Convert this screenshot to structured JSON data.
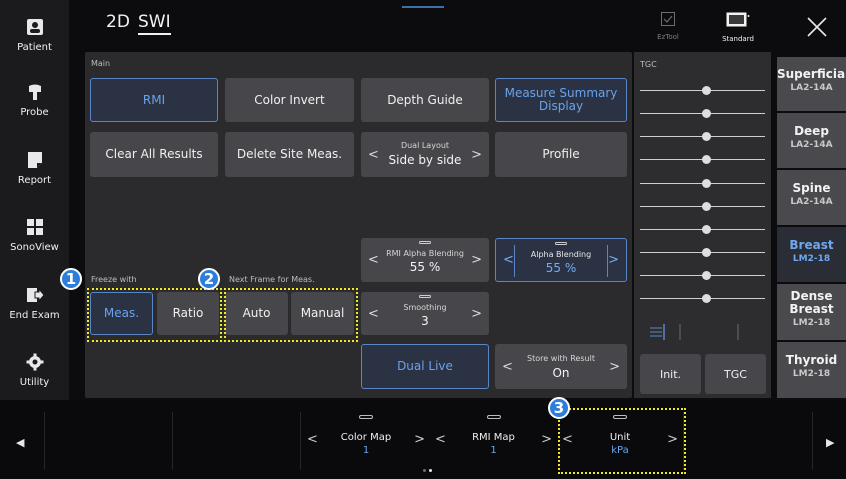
{
  "sidebar": {
    "items": [
      {
        "label": "Patient",
        "icon": "patient-icon"
      },
      {
        "label": "Probe",
        "icon": "probe-icon"
      },
      {
        "label": "Report",
        "icon": "report-icon"
      },
      {
        "label": "SonoView",
        "icon": "sonoview-icon"
      },
      {
        "label": "End Exam",
        "icon": "end-exam-icon"
      },
      {
        "label": "Utility",
        "icon": "gear-icon"
      }
    ]
  },
  "header": {
    "mode_2d": "2D",
    "mode_swi": "SWI",
    "eztool_label": "EzTool",
    "standard_label": "Standard"
  },
  "main": {
    "section_main": "Main",
    "rmi": "RMI",
    "color_invert": "Color Invert",
    "depth_guide": "Depth Guide",
    "measure_summary": "Measure Summary Display",
    "clear_all": "Clear All Results",
    "delete_site": "Delete Site Meas.",
    "dual_layout": {
      "caption": "Dual Layout",
      "value": "Side by side"
    },
    "profile": "Profile",
    "rmi_alpha": {
      "caption": "RMI Alpha Blending",
      "value": "55 %"
    },
    "alpha_blending": {
      "caption": "Alpha Blending",
      "value": "55 %"
    },
    "freeze_with_label": "Freeze with",
    "meas": "Meas.",
    "ratio": "Ratio",
    "next_frame_label": "Next Frame for Meas.",
    "auto": "Auto",
    "manual": "Manual",
    "smoothing": {
      "caption": "Smoothing",
      "value": "3"
    },
    "dual_live": "Dual Live",
    "store_with_result": {
      "caption": "Store with Result",
      "value": "On"
    }
  },
  "tgc": {
    "label": "TGC",
    "init": "Init.",
    "tgc_button": "TGC"
  },
  "presets": [
    {
      "name": "Superficial",
      "transducer": "LA2-14A",
      "active": false
    },
    {
      "name": "Deep",
      "transducer": "LA2-14A",
      "active": false
    },
    {
      "name": "Spine",
      "transducer": "LA2-14A",
      "active": false
    },
    {
      "name": "Breast",
      "transducer": "LM2-18",
      "active": true
    },
    {
      "name": "Dense Breast",
      "transducer": "LM2-18",
      "active": false
    },
    {
      "name": "Thyroid",
      "transducer": "LM2-18",
      "active": false
    }
  ],
  "bottom": {
    "color_map": {
      "caption": "Color Map",
      "value": "1"
    },
    "rmi_map": {
      "caption": "RMI Map",
      "value": "1"
    },
    "unit": {
      "caption": "Unit",
      "value": "kPa"
    }
  },
  "callouts": [
    "1",
    "2",
    "3"
  ],
  "colors": {
    "accent": "#68a3ec",
    "highlight": "#f2ea1c",
    "badge": "#2d7ddc"
  }
}
